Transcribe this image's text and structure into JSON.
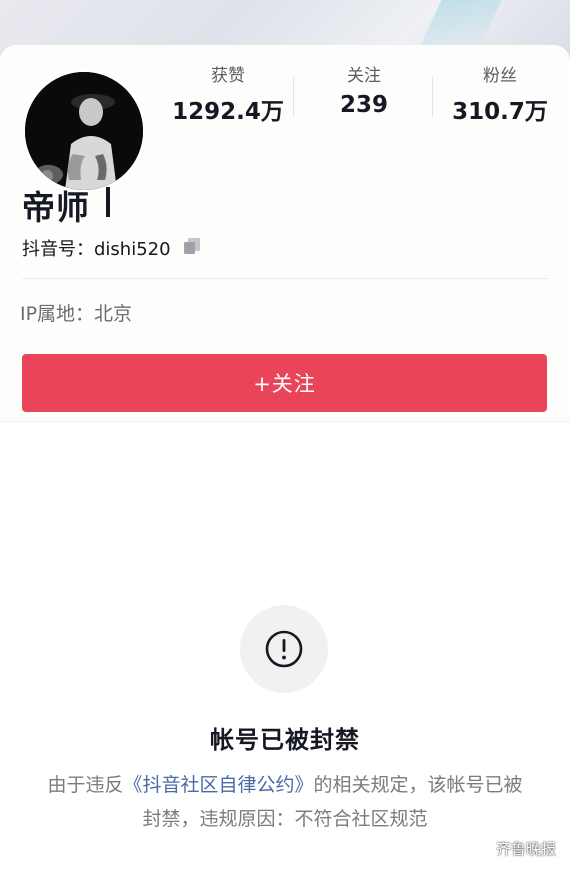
{
  "profile": {
    "stats": [
      {
        "label": "获赞",
        "value": "1292.4万"
      },
      {
        "label": "关注",
        "value": "239"
      },
      {
        "label": "粉丝",
        "value": "310.7万"
      }
    ],
    "username": "帝师",
    "douyin_id": "抖音号：dishi520",
    "ip_location": "IP属地：北京",
    "follow_button": "+关注"
  },
  "ban_notice": {
    "title": "帐号已被封禁",
    "desc_prefix": "由于违反",
    "desc_link": "《抖音社区自律公约》",
    "desc_suffix": "的相关规定，该帐号已被封禁，违规原因：不符合社区规范"
  },
  "watermark": "齐鲁晚报",
  "colors": {
    "follow_button": "#ea445a",
    "link": "#4a6aa5"
  },
  "icons": {
    "copy": "copy-icon",
    "ban": "exclamation-circle-icon",
    "watermark": "wechat-logo-icon"
  }
}
